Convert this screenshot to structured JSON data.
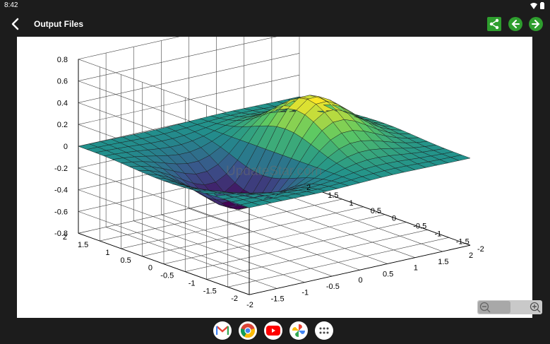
{
  "status_bar": {
    "time": "8:42",
    "icons": [
      "wifi-icon",
      "battery-icon"
    ]
  },
  "app_bar": {
    "title": "Output Files",
    "back_icon": "arrow-back-icon",
    "actions": [
      "share-icon",
      "previous-arrow-icon",
      "next-arrow-icon"
    ]
  },
  "plot": {
    "watermark": "UpdateStar.com",
    "z_ticks": [
      "0.8",
      "0.6",
      "0.4",
      "0.2",
      "0",
      "-0.2",
      "-0.4",
      "-0.6",
      "-0.8"
    ],
    "y_ticks": [
      "2",
      "1.5",
      "1",
      "0.5",
      "0",
      "-0.5",
      "-1",
      "-1.5",
      "-2"
    ],
    "x_ticks": [
      "-2",
      "-1.5",
      "-1",
      "-0.5",
      "0",
      "0.5",
      "1",
      "1.5",
      "2"
    ]
  },
  "chart_data": {
    "type": "surface",
    "function": "z = x * exp(-x^2 - y^2)",
    "x_range": [
      -2,
      2
    ],
    "y_range": [
      -2,
      2
    ],
    "z_range": [
      -0.8,
      0.8
    ],
    "colormap": "viridis",
    "grid": true
  },
  "dock": {
    "apps": [
      "gmail-icon",
      "chrome-icon",
      "youtube-icon",
      "photos-icon",
      "app-drawer-icon"
    ]
  },
  "colors": {
    "bar_bg": "#1c1c1c",
    "action_green": "#2e9e2e"
  }
}
